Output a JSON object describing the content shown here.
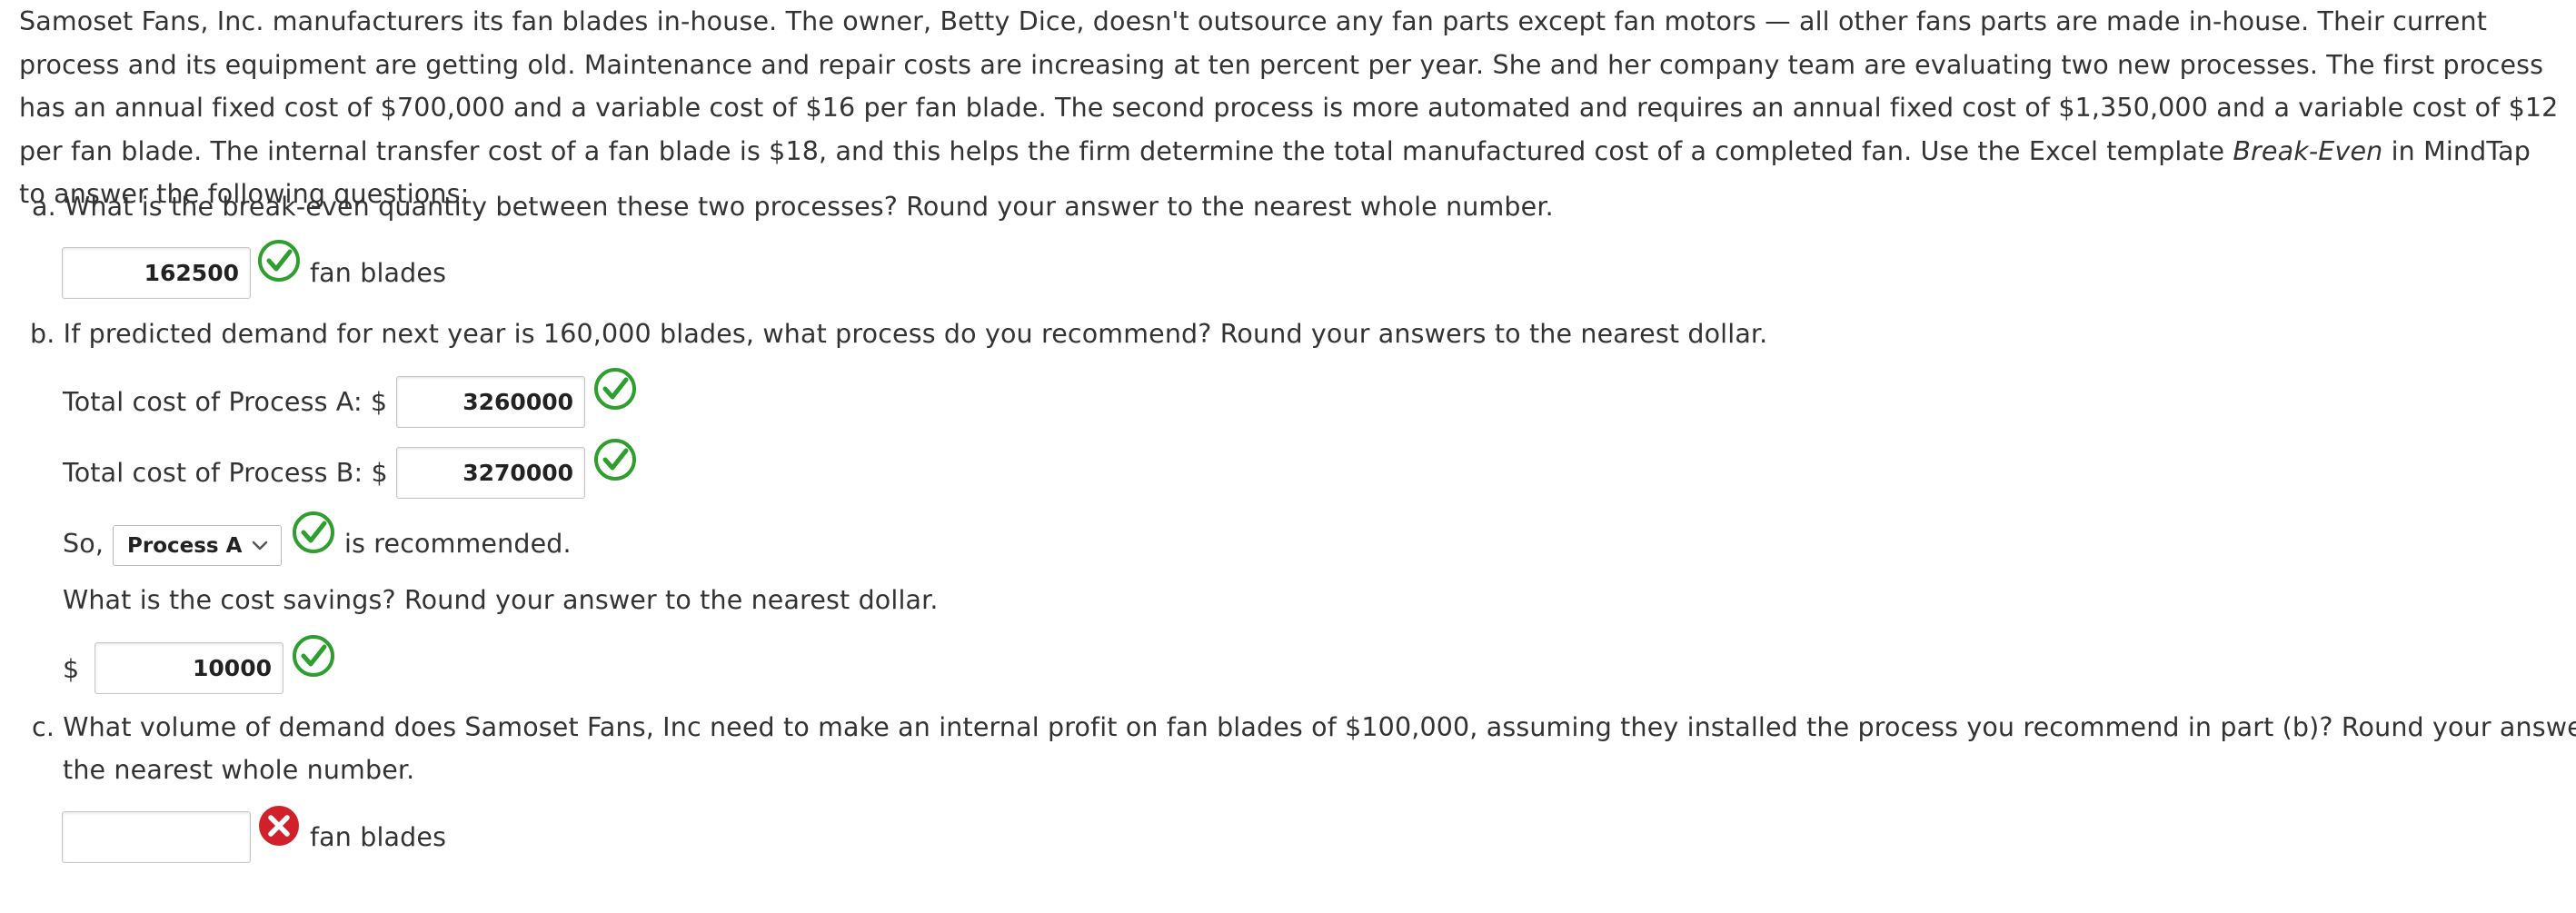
{
  "intro": {
    "text_before": "Samoset Fans, Inc. manufacturers its fan blades in-house. The owner, Betty Dice, doesn't outsource any fan parts except fan motors — all other fans parts are made in-house. Their current process and its equipment are getting old. Maintenance and repair costs are increasing at ten percent per year. She and her company team are evaluating two new processes. The first process has an annual fixed cost of $700,000 and a variable cost of $16 per fan blade. The second process is more automated and requires an annual fixed cost of $1,350,000 and a variable cost of $12 per fan blade. The internal transfer cost of a fan blade is $18, and this helps the firm determine the total manufactured cost of a completed fan. Use the Excel template ",
    "template_name": "Break-Even",
    "text_after": " in MindTap to answer the following questions:"
  },
  "part_a": {
    "question": "a. What is the break-even quantity between these two processes? Round your answer to the nearest whole number.",
    "answer": "162500",
    "status": "correct",
    "unit": "fan blades"
  },
  "part_b": {
    "question": "b. If predicted demand for next year is 160,000 blades, what process do you recommend? Round your answers to the nearest dollar.",
    "cost_a_label": "Total cost of Process A: $",
    "cost_a_value": "3260000",
    "cost_a_status": "correct",
    "cost_b_label": "Total cost of Process B: $",
    "cost_b_value": "3270000",
    "cost_b_status": "correct",
    "so_prefix": "So,",
    "recommended_selected": "Process A",
    "recommended_status": "correct",
    "so_suffix": "is recommended.",
    "savings_question": "What is the cost savings? Round your answer to the nearest dollar.",
    "savings_currency": "$",
    "savings_value": "10000",
    "savings_status": "correct"
  },
  "part_c": {
    "question_line1": "c. What volume of demand does Samoset Fans, Inc need to make an internal profit on fan blades of $100,000, assuming they installed the process you recommend in part (b)? Round your answer to",
    "question_line2": "the nearest whole number.",
    "answer": "",
    "status": "incorrect",
    "unit": "fan blades"
  },
  "icons": {
    "correct": "check-circle-icon",
    "incorrect": "x-circle-icon",
    "dropdown": "chevron-down-icon"
  },
  "colors": {
    "correct_green": "#2e9e2e",
    "incorrect_red": "#d0202a",
    "text": "#333333"
  }
}
